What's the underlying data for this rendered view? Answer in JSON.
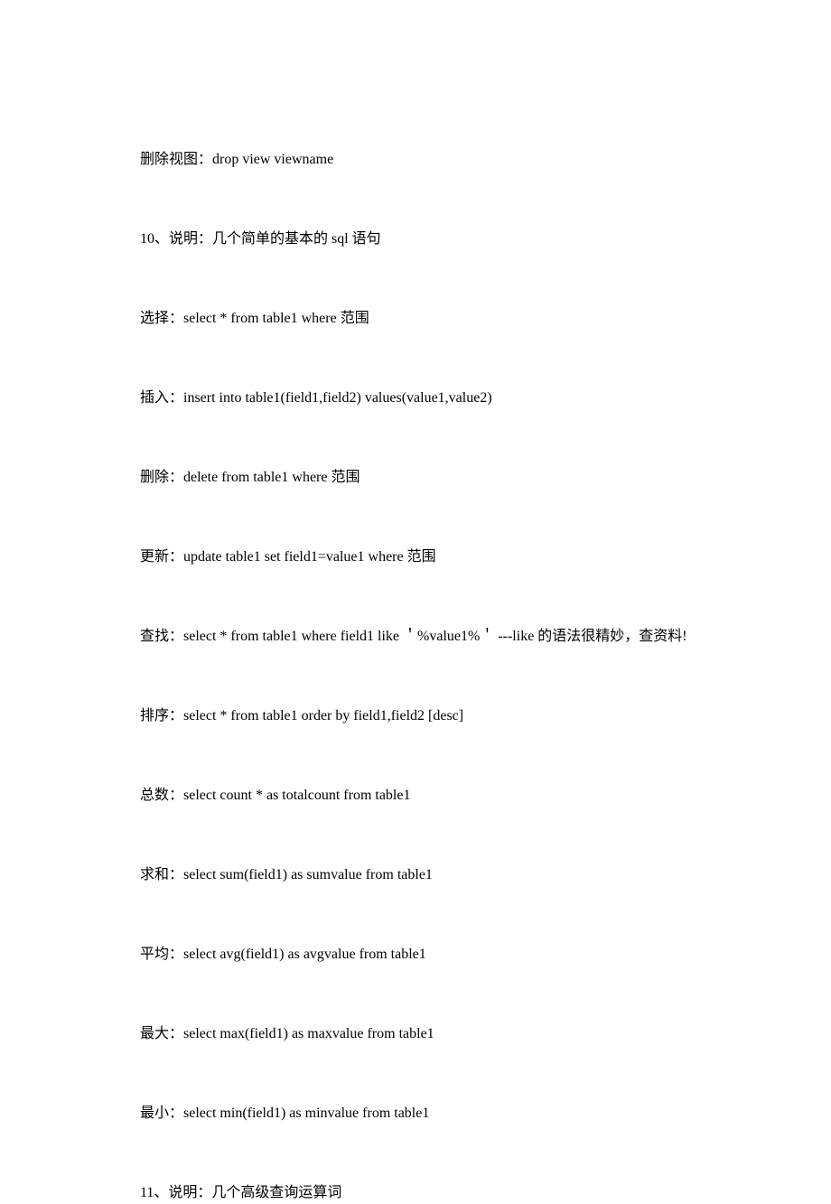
{
  "lines": [
    "删除视图：drop view viewname",
    "10、说明：几个简单的基本的 sql 语句",
    "选择：select * from table1 where  范围",
    "插入：insert into table1(field1,field2) values(value1,value2)",
    "删除：delete from table1 where  范围",
    "更新：update table1 set field1=value1 where  范围",
    "查找：select * from table1 where field1 like ＇%value1%＇ ---like 的语法很精妙，查资料!",
    "排序：select * from table1 order by field1,field2 [desc]",
    "总数：select count * as totalcount from table1",
    "求和：select sum(field1) as sumvalue from table1",
    "平均：select avg(field1) as avgvalue from table1",
    "最大：select max(field1) as maxvalue from table1",
    "最小：select min(field1) as minvalue from table1",
    "11、说明：几个高级查询运算词"
  ]
}
